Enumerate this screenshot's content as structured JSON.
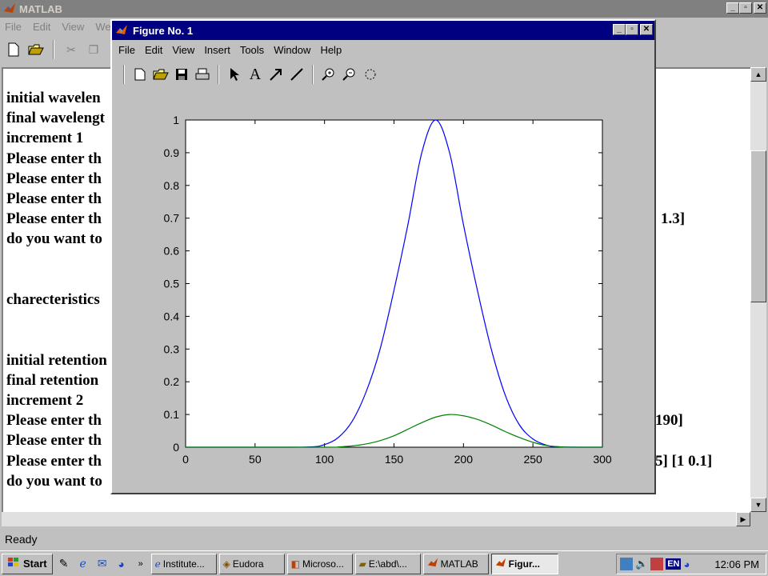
{
  "main_window": {
    "title": "MATLAB",
    "menu": [
      "File",
      "Edit",
      "View",
      "We"
    ],
    "status": "Ready"
  },
  "command_window": {
    "lines": [
      "initial wavelen",
      "final wavelengt",
      "increment  1",
      "Please enter th",
      "Please enter th",
      "Please enter th",
      "Please enter th",
      "do you want to",
      "",
      "",
      "charecteristics",
      "",
      "",
      "initial retention",
      "final retention",
      "increment  2",
      "Please enter th",
      "Please enter th",
      "Please enter th",
      "do you want to"
    ],
    "right_fragments": [
      {
        "line": 6,
        "text": "1.3]"
      },
      {
        "line": 16,
        "text": "190]"
      },
      {
        "line": 18,
        "text": "5]  [1 0.1]"
      }
    ]
  },
  "figure_window": {
    "title": "Figure No. 1",
    "menu": [
      "File",
      "Edit",
      "View",
      "Insert",
      "Tools",
      "Window",
      "Help"
    ],
    "toolbar_icons": [
      "new-file-icon",
      "open-folder-icon",
      "save-icon",
      "print-icon",
      "arrow-select-icon",
      "text-A-icon",
      "draw-arrow-icon",
      "draw-line-icon",
      "zoom-in-icon",
      "zoom-out-icon",
      "rotate-icon"
    ]
  },
  "chart_data": {
    "type": "line",
    "xlim": [
      0,
      300
    ],
    "ylim": [
      0,
      1
    ],
    "xticks": [
      0,
      50,
      100,
      150,
      200,
      250,
      300
    ],
    "yticks": [
      0,
      0.1,
      0.2,
      0.3,
      0.4,
      0.5,
      0.6,
      0.7,
      0.8,
      0.9,
      1
    ],
    "series": [
      {
        "color": "#0000ff",
        "x": [
          0,
          60,
          90,
          100,
          110,
          120,
          130,
          140,
          150,
          160,
          170,
          180,
          190,
          200,
          210,
          220,
          230,
          240,
          250,
          260,
          270,
          300
        ],
        "y": [
          0,
          0,
          0.001,
          0.008,
          0.03,
          0.08,
          0.17,
          0.3,
          0.48,
          0.68,
          0.9,
          1.0,
          0.9,
          0.68,
          0.48,
          0.3,
          0.16,
          0.07,
          0.025,
          0.006,
          0.001,
          0
        ]
      },
      {
        "color": "#008000",
        "x": [
          0,
          100,
          110,
          120,
          130,
          140,
          150,
          160,
          170,
          180,
          190,
          200,
          210,
          220,
          230,
          240,
          250,
          260,
          270,
          280,
          300
        ],
        "y": [
          0,
          0,
          0.001,
          0.004,
          0.01,
          0.02,
          0.035,
          0.055,
          0.075,
          0.092,
          0.1,
          0.096,
          0.085,
          0.068,
          0.048,
          0.03,
          0.015,
          0.005,
          0.001,
          0,
          0
        ]
      }
    ]
  },
  "taskbar": {
    "start_label": "Start",
    "tasks": [
      {
        "label": "Institute...",
        "active": false
      },
      {
        "label": "Eudora",
        "active": false
      },
      {
        "label": "Microso...",
        "active": false
      },
      {
        "label": "E:\\abd\\...",
        "active": false
      },
      {
        "label": "MATLAB",
        "active": false
      },
      {
        "label": "Figur...",
        "active": true
      }
    ],
    "tray_lang": "EN",
    "clock": "12:06 PM"
  }
}
